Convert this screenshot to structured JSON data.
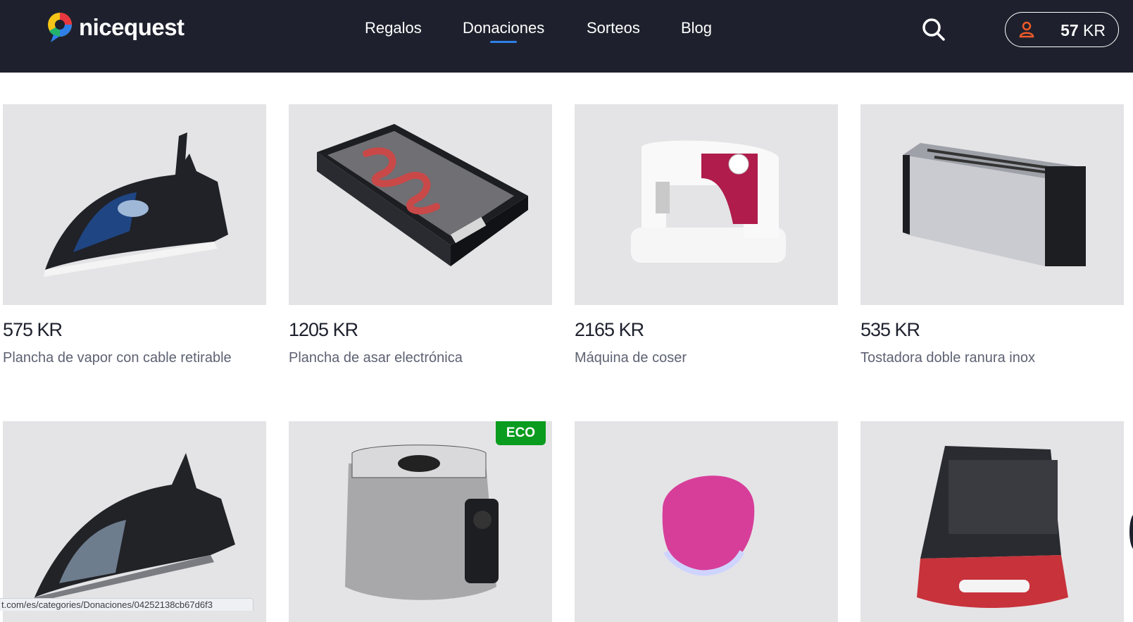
{
  "header": {
    "brand": "nicequest",
    "nav": [
      "Regalos",
      "Donaciones",
      "Sorteos",
      "Blog"
    ],
    "active_nav": "Donaciones",
    "balance_value": "57",
    "balance_unit": "KR"
  },
  "products": [
    {
      "price": "575 KR",
      "title": "Plancha de vapor con cable retirable"
    },
    {
      "price": "1205 KR",
      "title": "Plancha de asar electrónica"
    },
    {
      "price": "2165 KR",
      "title": "Máquina de coser"
    },
    {
      "price": "535 KR",
      "title": "Tostadora doble ranura inox"
    },
    {
      "price": "",
      "title": ""
    },
    {
      "price": "",
      "title": "",
      "badge": "ECO"
    },
    {
      "price": "",
      "title": ""
    },
    {
      "price": "",
      "title": ""
    }
  ],
  "status_url": "t.com/es/categories/Donaciones/04252138cb67d6f3",
  "colors": {
    "header_bg": "#1e212d",
    "accent": "#2f7fe8",
    "eco": "#0a9c1e",
    "user_icon": "#f05a28"
  }
}
